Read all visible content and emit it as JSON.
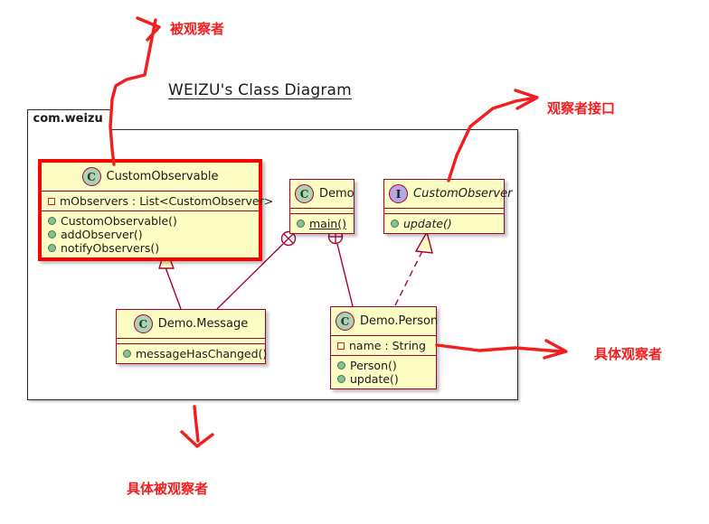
{
  "diagram": {
    "title": "WEIZU's Class Diagram",
    "package_name": "com.weizu",
    "colors": {
      "class_fill": "#fdfdc4",
      "class_border": "#a80036",
      "highlight_border": "#ff0000",
      "annotation": "#f41d1d",
      "class_icon_fill": "#add1b2",
      "interface_icon_fill": "#b4a7e5",
      "public_member": "#84bf96",
      "private_member": "#c82930",
      "package_border": "#2b2b2b"
    }
  },
  "classes": {
    "custom_observable": {
      "icon": "class-icon",
      "icon_letter": "C",
      "name": "CustomObservable",
      "fields": [
        {
          "marker": "private-field-icon",
          "text": "mObservers : List<CustomObserver>"
        }
      ],
      "methods": [
        {
          "marker": "public-method-icon",
          "text": "CustomObservable()"
        },
        {
          "marker": "public-method-icon",
          "text": "addObserver()"
        },
        {
          "marker": "public-method-icon",
          "text": "notifyObservers()"
        }
      ]
    },
    "demo": {
      "icon": "class-icon",
      "icon_letter": "C",
      "name": "Demo",
      "fields": [],
      "methods": [
        {
          "marker": "public-method-icon",
          "text": "main()"
        }
      ]
    },
    "custom_observer": {
      "icon": "interface-icon",
      "icon_letter": "I",
      "name": "CustomObserver",
      "fields": [],
      "methods": [
        {
          "marker": "public-method-icon",
          "text": "update()"
        }
      ]
    },
    "demo_message": {
      "icon": "class-icon",
      "icon_letter": "C",
      "name": "Demo.Message",
      "fields": [],
      "methods": [
        {
          "marker": "public-method-icon",
          "text": "messageHasChanged()"
        }
      ]
    },
    "demo_person": {
      "icon": "class-icon",
      "icon_letter": "C",
      "name": "Demo.Person",
      "fields": [
        {
          "marker": "private-field-icon",
          "text": "name : String"
        }
      ],
      "methods": [
        {
          "marker": "public-method-icon",
          "text": "Person()"
        },
        {
          "marker": "public-method-icon",
          "text": "update()"
        }
      ]
    }
  },
  "annotations": {
    "observable": "被观察者",
    "observer_interface": "观察者接口",
    "concrete_observer": "具体观察者",
    "concrete_observable": "具体被观察者"
  },
  "relationships": [
    {
      "from": "Demo.Message",
      "to": "CustomObservable",
      "type": "generalization"
    },
    {
      "from": "Demo.Message",
      "to": "Demo",
      "type": "containment"
    },
    {
      "from": "Demo.Person",
      "to": "Demo",
      "type": "containment"
    },
    {
      "from": "Demo.Person",
      "to": "CustomObserver",
      "type": "realization"
    }
  ]
}
